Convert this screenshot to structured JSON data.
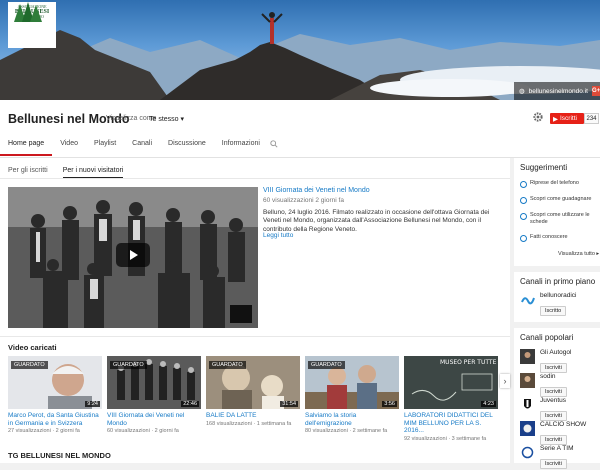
{
  "logo": {
    "line1": "ASSOCIAZIONE",
    "line2": "BELLUNESI",
    "line3": "NEL MONDO"
  },
  "banner": {
    "link_text": "bellunesinelmondo.it",
    "gplus": "G+"
  },
  "channel": {
    "title": "Bellunesi nel Mondo",
    "view_as_label": "Visualizza come",
    "view_as_value": "Te stesso ▾",
    "subscribe_label": "Iscritti",
    "subscriber_count": "234"
  },
  "tabs": [
    "Home page",
    "Video",
    "Playlist",
    "Canali",
    "Discussione",
    "Informazioni"
  ],
  "subtabs": [
    "Per gli iscritti",
    "Per i nuovi visitatori"
  ],
  "featured": {
    "title": "VIII Giornata dei Veneti nel Mondo",
    "meta": "60 visualizzazioni   2 giorni fa",
    "description": "Belluno, 24 luglio 2016. Filmato realizzato in occasione dell'ottava Giornata dei Veneti nel Mondo, organizzata dall'Associazione Bellunesi nel Mondo, con il contributo della Regione Veneto.",
    "more": "Leggi tutto"
  },
  "uploads": {
    "title": "Video caricati",
    "watched_label": "GUARDATO",
    "videos": [
      {
        "title": "Marco Perot, da Santa Giustina in Germania e in Svizzera",
        "meta": "27 visualizzazioni · 2 giorni fa",
        "duration": "9:24",
        "watched": true
      },
      {
        "title": "VIII Giornata dei Veneti nel Mondo",
        "meta": "60 visualizzazioni · 2 giorni fa",
        "duration": "22:46",
        "watched": true
      },
      {
        "title": "BALIE DA LATTE",
        "meta": "168 visualizzazioni · 1 settimana fa",
        "duration": "31:54",
        "watched": true
      },
      {
        "title": "Salviamo la storia dell'emigrazione",
        "meta": "80 visualizzazioni · 2 settimane fa",
        "duration": "3:56",
        "watched": true
      },
      {
        "title": "LABORATORI DIDATTICI DEL MIM BELLUNO PER LA S. 2016...",
        "meta": "92 visualizzazioni · 3 settimane fa",
        "duration": "4:23",
        "watched": false,
        "thumb_text": "MUSEO PER TUTTE"
      }
    ]
  },
  "section2_title": "TG BELLUNESI NEL MONDO",
  "suggestions": {
    "title": "Suggerimenti",
    "items": [
      "Riprese del telefono",
      "Scopri come guadagnare",
      "Scopri come utilizzare le schede",
      "Fatti conoscere"
    ],
    "next": "Visualizza tutto ▸"
  },
  "featured_channels": {
    "title": "Canali in primo piano",
    "items": [
      {
        "name": "bellunoradici",
        "action": "Iscritto"
      }
    ]
  },
  "popular_channels": {
    "title": "Canali popolari",
    "items": [
      {
        "name": "Gli Autogol",
        "action": "Iscriviti"
      },
      {
        "name": "sodin",
        "action": "Iscriviti"
      },
      {
        "name": "Juventus",
        "action": "Iscriviti"
      },
      {
        "name": "CALCIO SHOW",
        "action": "Iscriviti"
      },
      {
        "name": "Serie A TIM",
        "action": "Iscriviti"
      }
    ]
  },
  "colors": {
    "accent": "#cc181e",
    "link": "#167ac6",
    "subscribe": "#e62117"
  }
}
